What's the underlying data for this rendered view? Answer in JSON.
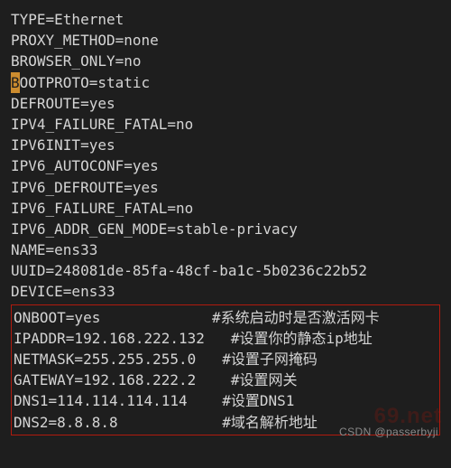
{
  "lines": [
    {
      "key": "TYPE",
      "value": "Ethernet"
    },
    {
      "key": "PROXY_METHOD",
      "value": "none"
    },
    {
      "key": "BROWSER_ONLY",
      "value": "no"
    },
    {
      "key": "BOOTPROTO",
      "value": "static",
      "cursor_first": "B",
      "rest_key": "OOTPROTO"
    },
    {
      "key": "DEFROUTE",
      "value": "yes"
    },
    {
      "key": "IPV4_FAILURE_FATAL",
      "value": "no"
    },
    {
      "key": "IPV6INIT",
      "value": "yes"
    },
    {
      "key": "IPV6_AUTOCONF",
      "value": "yes"
    },
    {
      "key": "IPV6_DEFROUTE",
      "value": "yes"
    },
    {
      "key": "IPV6_FAILURE_FATAL",
      "value": "no"
    },
    {
      "key": "IPV6_ADDR_GEN_MODE",
      "value": "stable-privacy"
    },
    {
      "key": "NAME",
      "value": "ens33"
    },
    {
      "key": "UUID",
      "value": "248081de-85fa-48cf-ba1c-5b0236c22b52"
    },
    {
      "key": "DEVICE",
      "value": "ens33"
    }
  ],
  "boxed": [
    {
      "key": "ONBOOT",
      "value": "yes",
      "pad": "          ",
      "comment": "#系统启动时是否激活网卡"
    },
    {
      "key": "IPADDR",
      "value": "192.168.222.132",
      "pad": "   ",
      "comment": "#设置你的静态ip地址"
    },
    {
      "key": "NETMASK",
      "value": "255.255.255.0",
      "pad": "   ",
      "comment": "#设置子网掩码"
    },
    {
      "key": "GATEWAY",
      "value": "192.168.222.2",
      "pad": "    ",
      "comment": "#设置网关"
    },
    {
      "key": "DNS1",
      "value": "114.114.114.114",
      "pad": "    ",
      "comment": "#设置DNS1"
    },
    {
      "key": "DNS2",
      "value": "8.8.8.8",
      "pad": "            ",
      "comment": "#域名解析地址"
    }
  ],
  "footer": "CSDN @passerbyji",
  "watermark": "69.net"
}
